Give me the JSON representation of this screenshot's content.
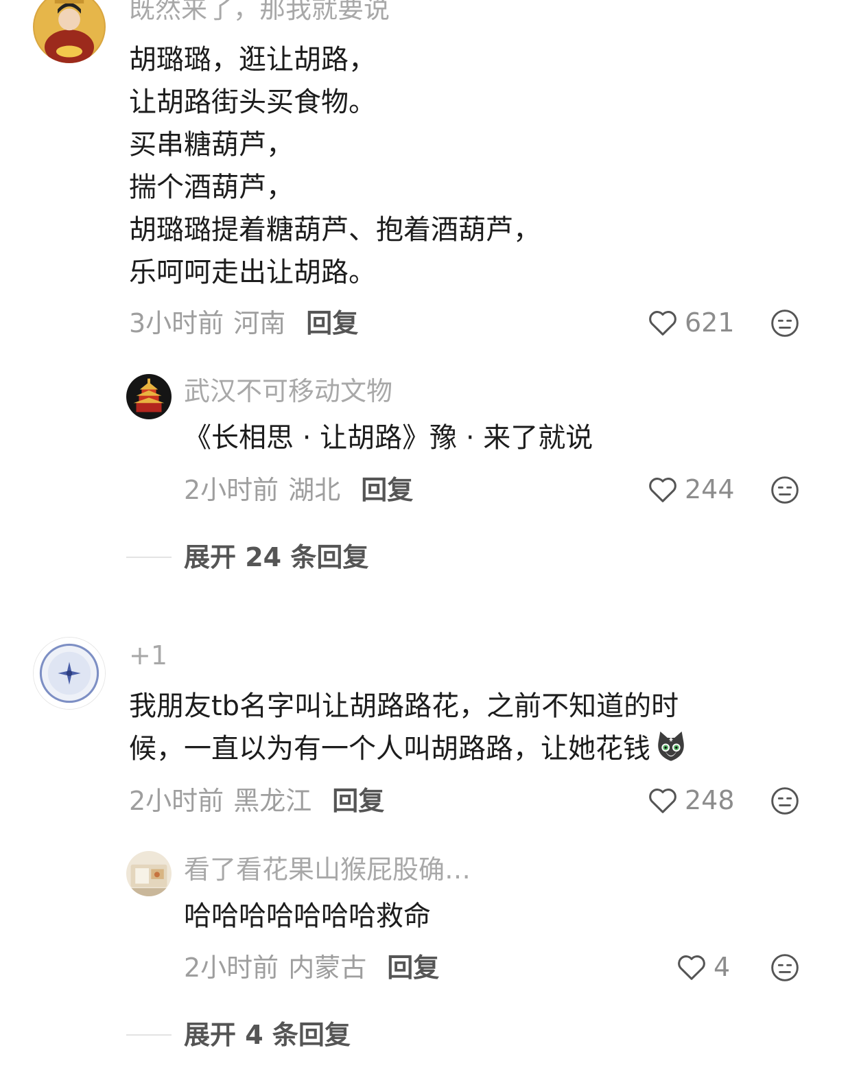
{
  "comments": [
    {
      "username": "既然来了，那我就要说",
      "text_lines": [
        "胡璐璐，逛让胡路，",
        "让胡路街头买食物。",
        "买串糖葫芦，",
        "揣个酒葫芦，",
        "胡璐璐提着糖葫芦、抱着酒葫芦，",
        "乐呵呵走出让胡路。"
      ],
      "time": "3小时前",
      "location": "河南",
      "reply_label": "回复",
      "likes": "621",
      "replies": [
        {
          "username": "武汉不可移动文物",
          "text": "《长相思 · 让胡路》豫 · 来了就说",
          "time": "2小时前",
          "location": "湖北",
          "reply_label": "回复",
          "likes": "244"
        }
      ],
      "expand_label": "展开 24 条回复"
    },
    {
      "username": "+1",
      "text_lines": [
        "我朋友tb名字叫让胡路路花，之前不知道的时",
        "候，一直以为有一个人叫胡路路，让她花钱"
      ],
      "emoji": "cat-sticker-icon",
      "time": "2小时前",
      "location": "黑龙江",
      "reply_label": "回复",
      "likes": "248",
      "replies": [
        {
          "username": "看了看花果山猴屁股确…",
          "text": "哈哈哈哈哈哈哈救命",
          "time": "2小时前",
          "location": "内蒙古",
          "reply_label": "回复",
          "likes": "4"
        }
      ],
      "expand_label": "展开 4 条回复"
    }
  ],
  "icons": {
    "like": "heart-outline-icon",
    "dislike": "meh-face-icon"
  },
  "colors": {
    "username": "#a8a8a8",
    "body_text": "#1c1c1c",
    "meta": "#9e9e9e",
    "reply": "#555555"
  }
}
